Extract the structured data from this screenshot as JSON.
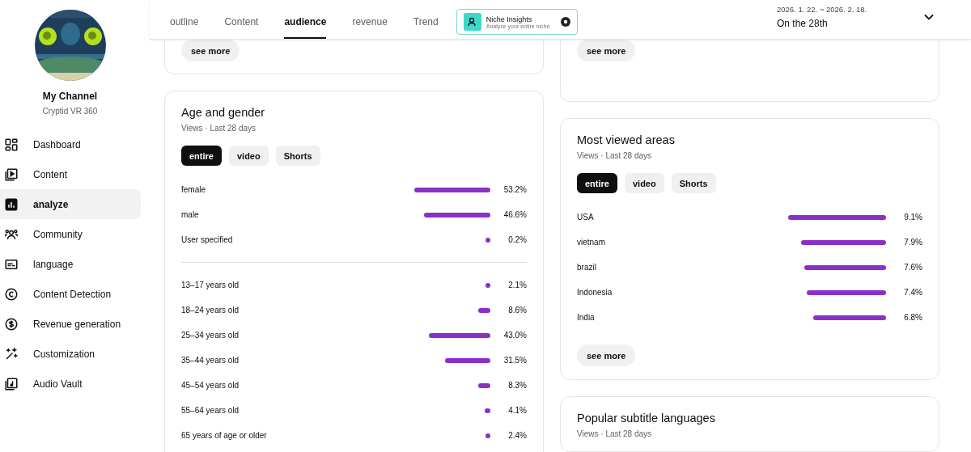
{
  "channel": {
    "name": "My Channel",
    "handle": "Cryptid VR 360"
  },
  "nav": [
    {
      "label": "Dashboard",
      "selected": false
    },
    {
      "label": "Content",
      "selected": false
    },
    {
      "label": "analyze",
      "selected": true
    },
    {
      "label": "Community",
      "selected": false
    },
    {
      "label": "language",
      "selected": false
    },
    {
      "label": "Content Detection",
      "selected": false
    },
    {
      "label": "Revenue generation",
      "selected": false
    },
    {
      "label": "Customization",
      "selected": false
    },
    {
      "label": "Audio Vault",
      "selected": false
    }
  ],
  "tabs": [
    {
      "label": "outline",
      "selected": false
    },
    {
      "label": "Content",
      "selected": false
    },
    {
      "label": "audience",
      "selected": true
    },
    {
      "label": "revenue",
      "selected": false
    },
    {
      "label": "Trend",
      "selected": false
    }
  ],
  "niche": {
    "title": "Niche Insights",
    "subtitle": "Analyze your entire niche"
  },
  "date_range": {
    "range": "2026. 1. 22. ~ 2026. 2. 18.",
    "label": "On the 28th"
  },
  "left_column": [
    {
      "kind": "partial",
      "button": "see more"
    },
    {
      "kind": "card",
      "title": "Age and gender",
      "subtitle": "Views · Last 28 days",
      "chips": [
        {
          "label": "entire",
          "selected": true
        },
        {
          "label": "video",
          "selected": false
        },
        {
          "label": "Shorts",
          "selected": false
        }
      ],
      "groups": [
        [
          {
            "label": "female",
            "value": "53.2%"
          },
          {
            "label": "male",
            "value": "46.6%"
          },
          {
            "label": "User specified",
            "value": "0.2%"
          }
        ],
        [
          {
            "label": "13–17 years old",
            "value": "2.1%"
          },
          {
            "label": "18–24 years old",
            "value": "8.6%"
          },
          {
            "label": "25–34 years old",
            "value": "43.0%"
          },
          {
            "label": "35–44 years old",
            "value": "31.5%"
          },
          {
            "label": "45–54 years old",
            "value": "8.3%"
          },
          {
            "label": "55–64 years old",
            "value": "4.1%"
          },
          {
            "label": "65 years of age or older",
            "value": "2.4%"
          }
        ]
      ]
    }
  ],
  "right_column": [
    {
      "kind": "partial",
      "button": "see more"
    },
    {
      "kind": "card",
      "title": "Most viewed areas",
      "subtitle": "Views · Last 28 days",
      "chips": [
        {
          "label": "entire",
          "selected": true
        },
        {
          "label": "video",
          "selected": false
        },
        {
          "label": "Shorts",
          "selected": false
        }
      ],
      "groups": [
        [
          {
            "label": "USA",
            "value": "9.1%"
          },
          {
            "label": "vietnam",
            "value": "7.9%"
          },
          {
            "label": "brazil",
            "value": "7.6%"
          },
          {
            "label": "Indonesia",
            "value": "7.4%"
          },
          {
            "label": "India",
            "value": "6.8%"
          }
        ]
      ],
      "button": "see more"
    },
    {
      "kind": "card",
      "title": "Popular subtitle languages",
      "subtitle": "Views · Last 28 days"
    }
  ]
}
